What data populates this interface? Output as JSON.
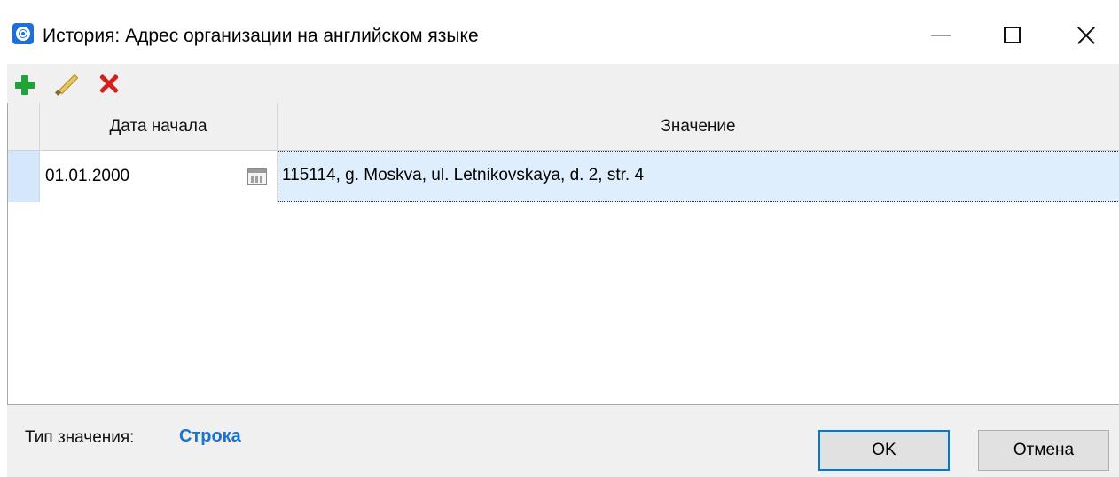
{
  "window": {
    "title": "История: Адрес организации на английском языке",
    "icon": "app-logo-icon",
    "controls": [
      "minimize-icon",
      "maximize-icon",
      "close-icon"
    ]
  },
  "toolbar": {
    "buttons": [
      {
        "name": "add",
        "icon": "plus-icon",
        "color": "#23a23a"
      },
      {
        "name": "edit",
        "icon": "pencil-icon",
        "color": "#e7c560"
      },
      {
        "name": "delete",
        "icon": "delete-x-icon",
        "color": "#d2201f"
      }
    ]
  },
  "grid": {
    "columns": [
      "Дата начала",
      "Значение"
    ],
    "rows": [
      {
        "date": "01.01.2000",
        "value": "115114, g. Moskva, ul. Letnikovskaya, d. 2, str. 4"
      }
    ],
    "selected_row_color": "#deeefc"
  },
  "footer": {
    "type_label": "Тип значения:",
    "type_value": "Строка",
    "type_value_color": "#1a73d1",
    "ok_label": "OK",
    "cancel_label": "Отмена"
  }
}
